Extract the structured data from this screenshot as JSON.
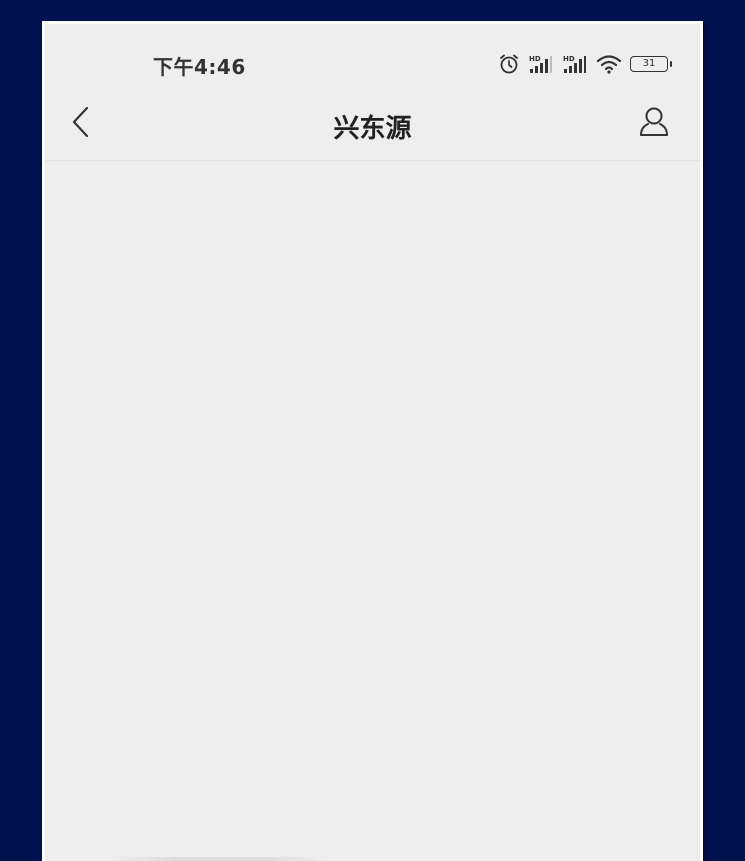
{
  "status_bar": {
    "time": "下午4:46",
    "icons": [
      "alarm-icon",
      "hd-signal-icon",
      "hd-signal-icon",
      "wifi-icon",
      "battery-icon"
    ],
    "signal_label": "HD",
    "battery_level": "31"
  },
  "nav_bar": {
    "title": "兴东源",
    "back_icon": "chevron-left-icon",
    "profile_icon": "user-icon"
  },
  "colors": {
    "background_outer": "#00114f",
    "screen_background": "#eeeeee",
    "text_primary": "#222222"
  }
}
